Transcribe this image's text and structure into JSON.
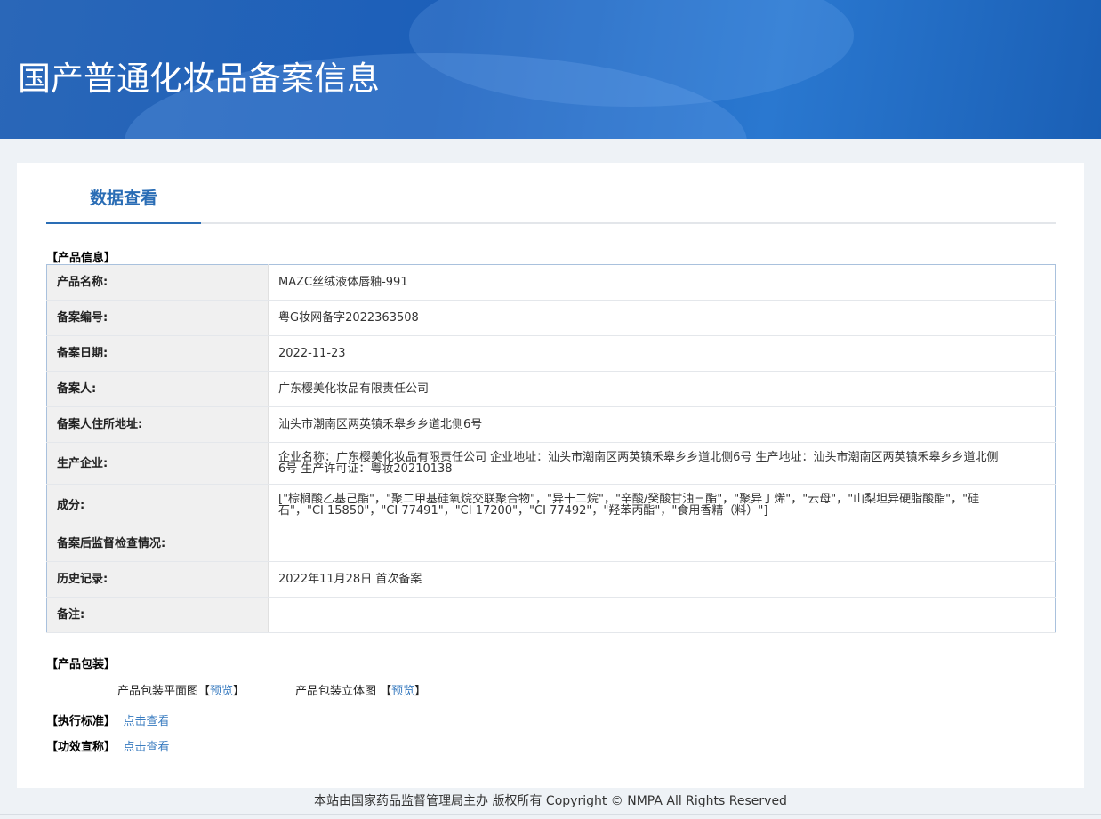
{
  "header": {
    "title": "国产普通化妆品备案信息"
  },
  "tabs": [
    {
      "label": "数据查看"
    }
  ],
  "product_info": {
    "section_title": "【产品信息】",
    "rows": [
      {
        "label": "产品名称:",
        "value": "MAZC丝绒液体唇釉-991"
      },
      {
        "label": "备案编号:",
        "value": "粤G妆网备字2022363508"
      },
      {
        "label": "备案日期:",
        "value": "2022-11-23"
      },
      {
        "label": "备案人:",
        "value": "广东樱美化妆品有限责任公司"
      },
      {
        "label": "备案人住所地址:",
        "value": "汕头市潮南区两英镇禾皋乡乡道北侧6号"
      },
      {
        "label": "生产企业:",
        "value": "企业名称：广东樱美化妆品有限责任公司 企业地址：汕头市潮南区两英镇禾皋乡乡道北侧6号 生产地址：汕头市潮南区两英镇禾皋乡乡道北侧6号 生产许可证：粤妆20210138"
      },
      {
        "label": "成分:",
        "value": "[\"棕榈酸乙基己酯\"，\"聚二甲基硅氧烷交联聚合物\"，\"异十二烷\"，\"辛酸/癸酸甘油三酯\"，\"聚异丁烯\"，\"云母\"，\"山梨坦异硬脂酸酯\"，\"硅石\"，\"CI 15850\"，\"CI 77491\"，\"CI 17200\"，\"CI 77492\"，\"羟苯丙酯\"，\"食用香精（料）\"]"
      },
      {
        "label": "备案后监督检查情况:",
        "value": ""
      },
      {
        "label": "历史记录:",
        "value": "2022年11月28日 首次备案"
      },
      {
        "label": "备注:",
        "value": ""
      }
    ]
  },
  "packaging": {
    "section_title": "【产品包装】",
    "flat_label": "产品包装平面图",
    "flat_link": "预览",
    "three_d_label": "产品包装立体图 ",
    "three_d_link": "预览",
    "bracket_open": "【",
    "bracket_close": "】"
  },
  "standard": {
    "section_title": "【执行标准】",
    "link": "点击查看"
  },
  "efficacy": {
    "section_title": "【功效宣称】",
    "link": "点击查看"
  },
  "footer": {
    "text": "本站由国家药品监督管理局主办 版权所有 Copyright © NMPA All Rights Reserved"
  }
}
